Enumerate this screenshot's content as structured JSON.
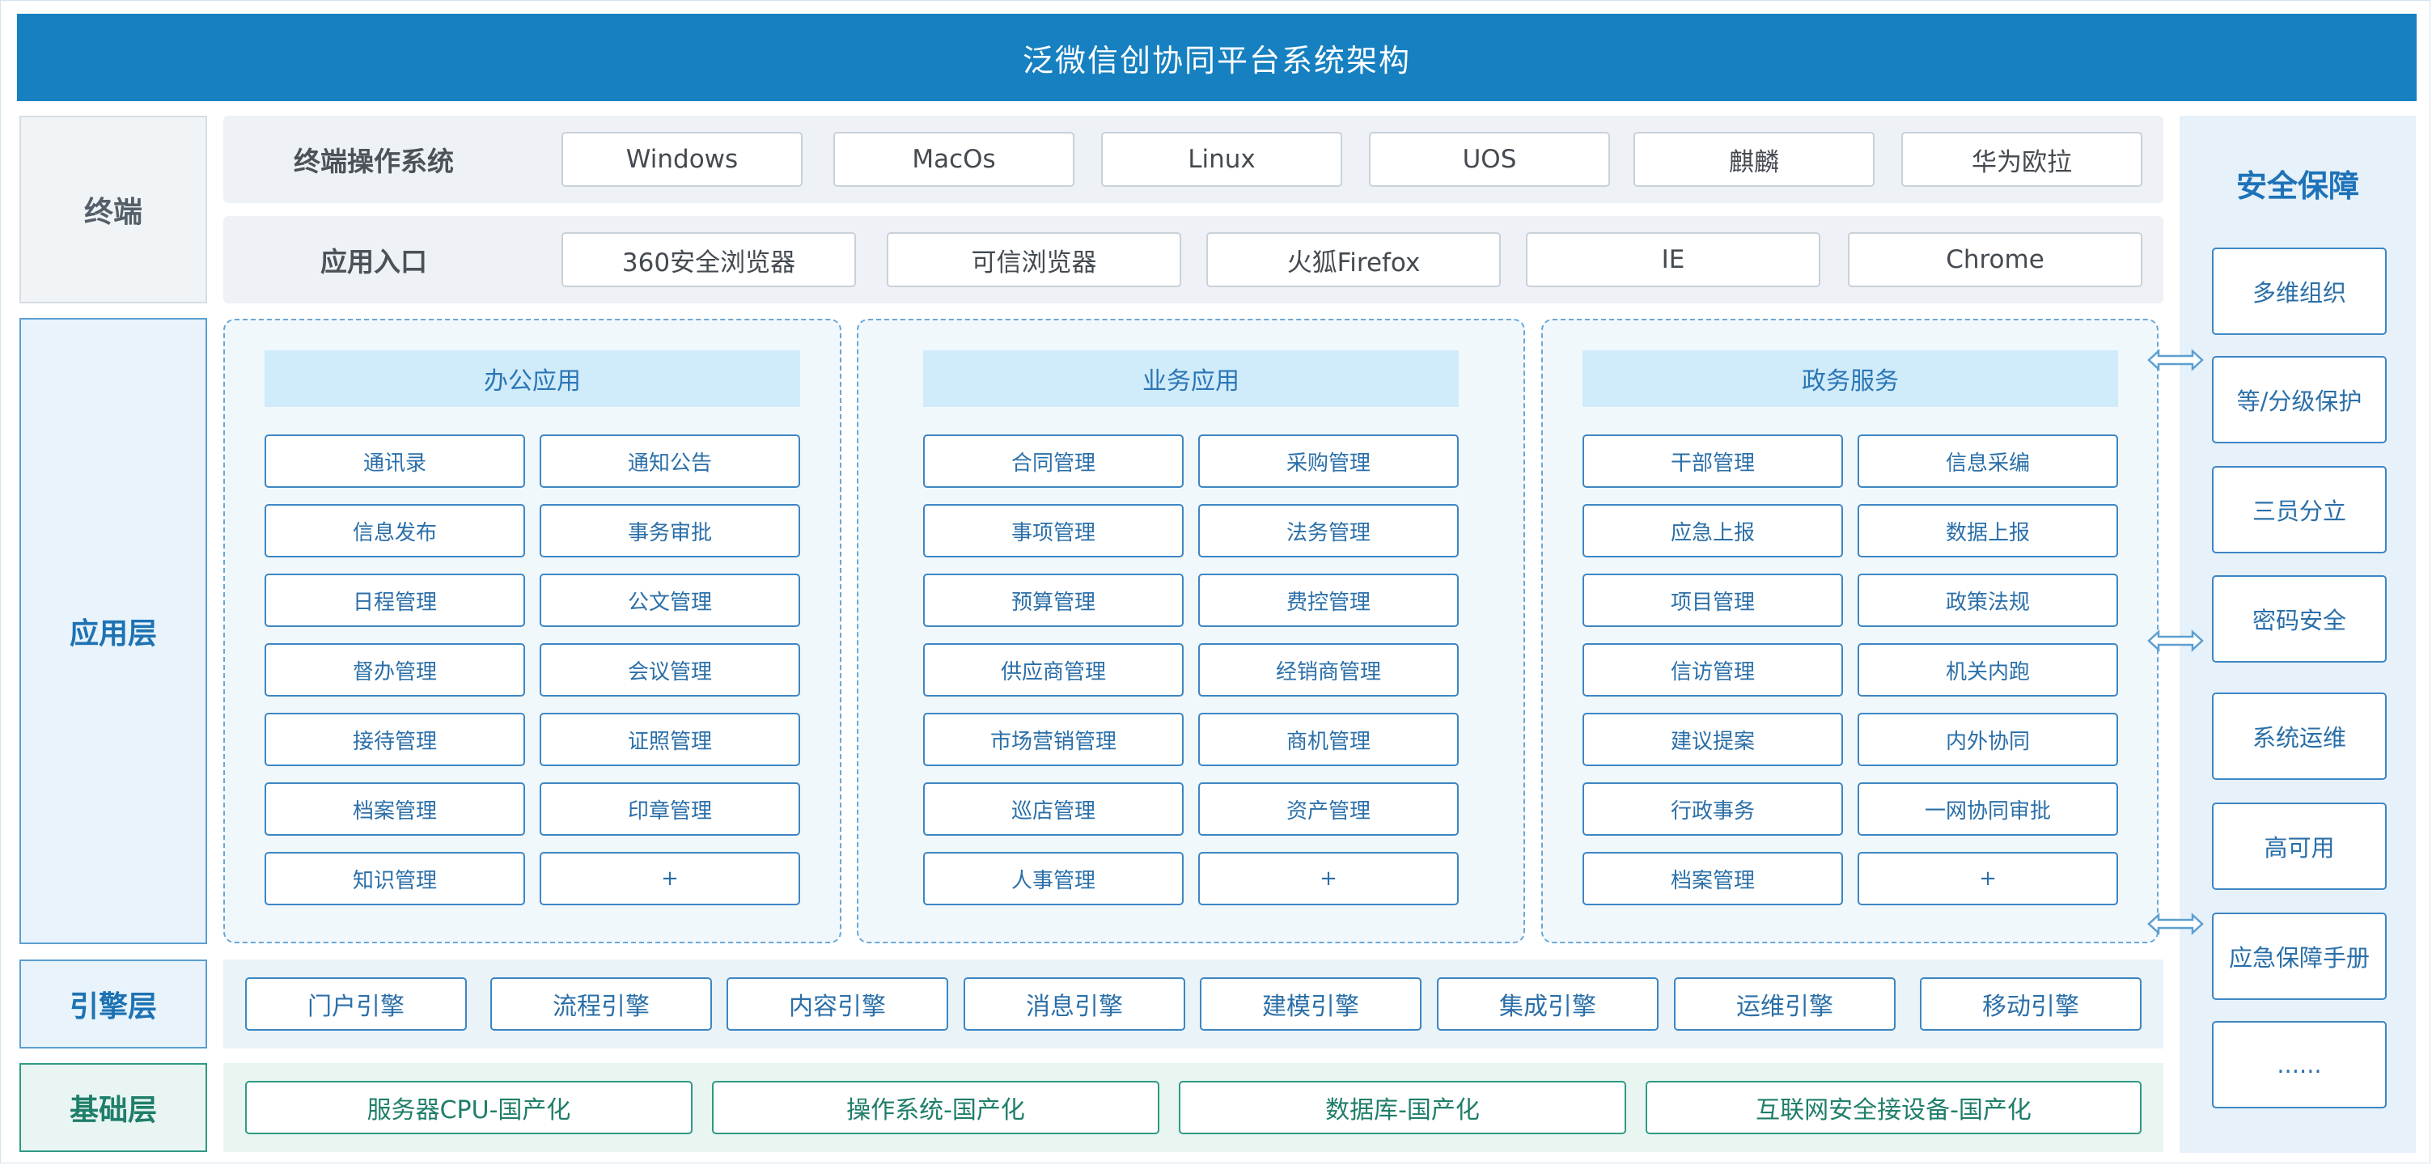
{
  "title": "泛微信创协同平台系统架构",
  "layers": {
    "terminal": "终端",
    "application": "应用层",
    "engine": "引擎层",
    "foundation": "基础层"
  },
  "terminal": {
    "os_title": "终端操作系统",
    "os_items": [
      "Windows",
      "MacOs",
      "Linux",
      "UOS",
      "麒麟",
      "华为欧拉"
    ],
    "entry_title": "应用入口",
    "entry_items": [
      "360安全浏览器",
      "可信浏览器",
      "火狐Firefox",
      "IE",
      "Chrome"
    ]
  },
  "panels": [
    {
      "title": "办公应用",
      "items": [
        "通讯录",
        "通知公告",
        "信息发布",
        "事务审批",
        "日程管理",
        "公文管理",
        "督办管理",
        "会议管理",
        "接待管理",
        "证照管理",
        "档案管理",
        "印章管理",
        "知识管理",
        "+"
      ]
    },
    {
      "title": "业务应用",
      "items": [
        "合同管理",
        "采购管理",
        "事项管理",
        "法务管理",
        "预算管理",
        "费控管理",
        "供应商管理",
        "经销商管理",
        "市场营销管理",
        "商机管理",
        "巡店管理",
        "资产管理",
        "人事管理",
        "+"
      ]
    },
    {
      "title": "政务服务",
      "items": [
        "干部管理",
        "信息采编",
        "应急上报",
        "数据上报",
        "项目管理",
        "政策法规",
        "信访管理",
        "机关内跑",
        "建议提案",
        "内外协同",
        "行政事务",
        "一网协同审批",
        "档案管理",
        "+"
      ]
    }
  ],
  "engines": [
    "门户引擎",
    "流程引擎",
    "内容引擎",
    "消息引擎",
    "建模引擎",
    "集成引擎",
    "运维引擎",
    "移动引擎"
  ],
  "foundation": [
    "服务器CPU-国产化",
    "操作系统-国产化",
    "数据库-国产化",
    "互联网安全接设备-国产化"
  ],
  "security": {
    "title": "安全保障",
    "items": [
      "多维组织",
      "等/分级保护",
      "三员分立",
      "密码安全",
      "系统运维",
      "高可用",
      "应急保障手册",
      "......"
    ]
  },
  "colors": {
    "banner": "#1680c0",
    "app_blue": "#3d86c3",
    "foundation_teal": "#2f9a84"
  }
}
